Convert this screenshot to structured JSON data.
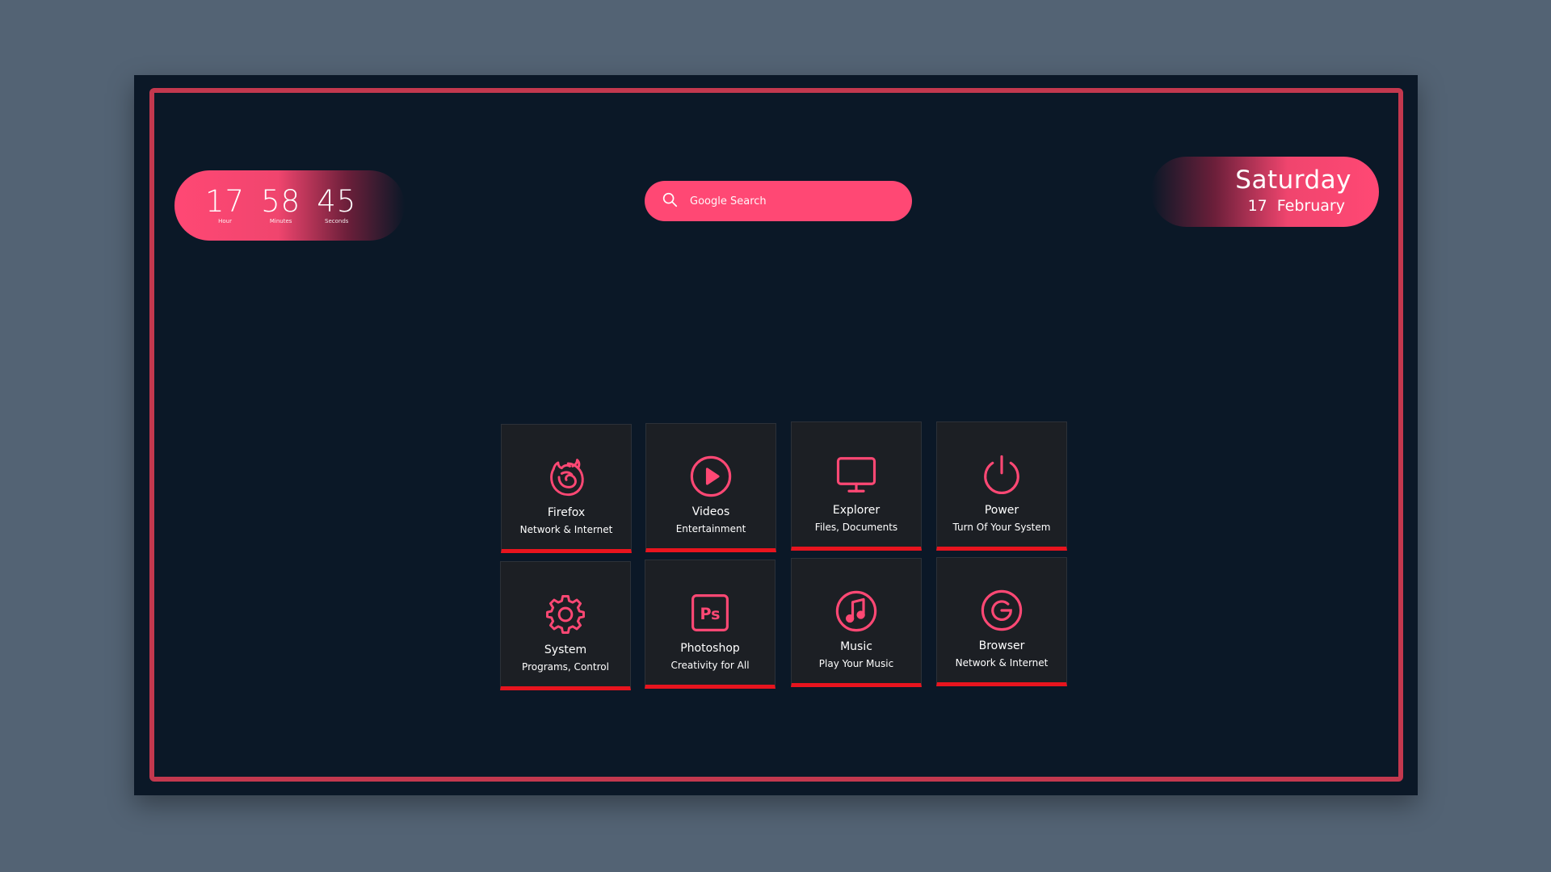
{
  "clock": {
    "hour": "17",
    "hour_label": "Hour",
    "minutes": "58",
    "minutes_label": "Minutes",
    "seconds": "45",
    "seconds_label": "Seconds"
  },
  "search": {
    "placeholder": "Google Search",
    "value": ""
  },
  "date": {
    "day": "Saturday",
    "date": "17 February"
  },
  "tiles": [
    {
      "title": "Firefox",
      "subtitle": "Network & Internet",
      "icon": "firefox-icon"
    },
    {
      "title": "Videos",
      "subtitle": "Entertainment",
      "icon": "play-circle-icon"
    },
    {
      "title": "Explorer",
      "subtitle": "Files, Documents",
      "icon": "monitor-icon"
    },
    {
      "title": "Power",
      "subtitle": "Turn Of Your System",
      "icon": "power-icon"
    },
    {
      "title": "System",
      "subtitle": "Programs, Control",
      "icon": "gear-icon"
    },
    {
      "title": "Photoshop",
      "subtitle": "Creativity for All",
      "icon": "photoshop-icon"
    },
    {
      "title": "Music",
      "subtitle": "Play Your Music",
      "icon": "music-note-icon"
    },
    {
      "title": "Browser",
      "subtitle": "Network & Internet",
      "icon": "google-icon"
    }
  ],
  "colors": {
    "accent": "#ff4874",
    "frame": "#c3384e",
    "background": "#0b1827",
    "outer_background": "#536374",
    "tile_background": "#1c1f24",
    "tile_underline": "#e8141e"
  }
}
